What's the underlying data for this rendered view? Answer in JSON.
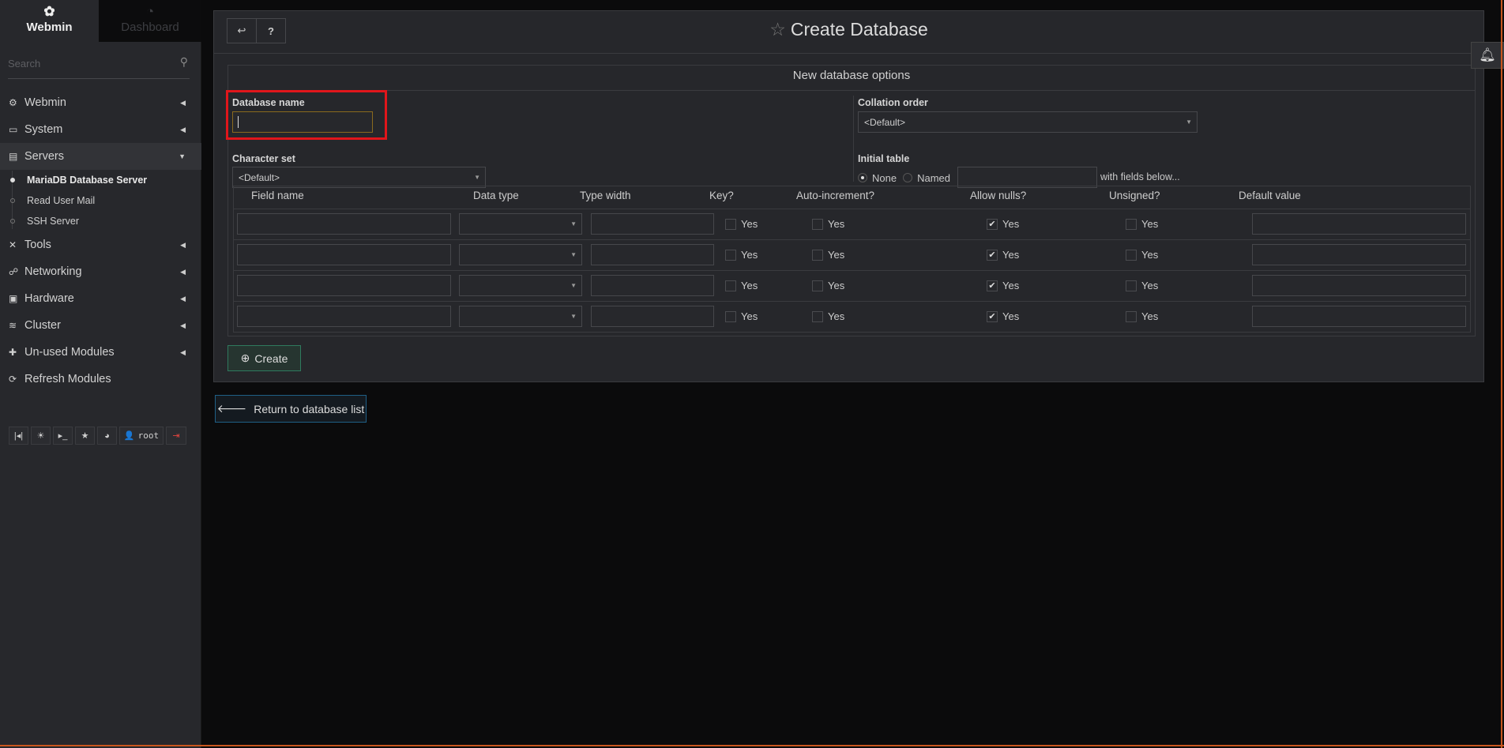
{
  "sidebar": {
    "tabs": [
      {
        "label": "Webmin",
        "icon": "webmin-logo-icon"
      },
      {
        "label": "Dashboard",
        "icon": "dashboard-gauge-icon"
      }
    ],
    "search_placeholder": "Search",
    "menu": [
      {
        "label": "Webmin",
        "icon": "gear-icon"
      },
      {
        "label": "System",
        "icon": "laptop-icon"
      },
      {
        "label": "Servers",
        "icon": "server-icon",
        "expanded": true
      },
      {
        "label": "Tools",
        "icon": "tools-icon"
      },
      {
        "label": "Networking",
        "icon": "network-icon"
      },
      {
        "label": "Hardware",
        "icon": "harddisk-icon"
      },
      {
        "label": "Cluster",
        "icon": "layers-icon"
      },
      {
        "label": "Un-used Modules",
        "icon": "puzzle-icon"
      },
      {
        "label": "Refresh Modules",
        "icon": "refresh-icon"
      }
    ],
    "submenu": [
      {
        "label": "MariaDB Database Server",
        "active": true
      },
      {
        "label": "Read User Mail"
      },
      {
        "label": "SSH Server"
      }
    ],
    "bottom": {
      "user": "root"
    }
  },
  "page": {
    "title": "Create Database"
  },
  "form": {
    "legend": "New database options",
    "db_name_label": "Database name",
    "db_name_value": "",
    "charset_label": "Character set",
    "charset_value": "<Default>",
    "collation_label": "Collation order",
    "collation_value": "<Default>",
    "initial_table_label": "Initial table",
    "radio_none": "None",
    "radio_named": "Named",
    "fields_suffix": "with fields below...",
    "columns": [
      "Field name",
      "Data type",
      "Type width",
      "Key?",
      "Auto-increment?",
      "Allow nulls?",
      "Unsigned?",
      "Default value"
    ],
    "rows": [
      {
        "key": false,
        "auto": false,
        "nulls": true,
        "unsigned": false
      },
      {
        "key": false,
        "auto": false,
        "nulls": true,
        "unsigned": false
      },
      {
        "key": false,
        "auto": false,
        "nulls": true,
        "unsigned": false
      },
      {
        "key": false,
        "auto": false,
        "nulls": true,
        "unsigned": false
      }
    ],
    "yes": "Yes",
    "create_label": "Create"
  },
  "return_label": "Return to database list",
  "colors": {
    "highlight": "#e0161b",
    "create_border": "#2f7a5e",
    "return_border": "#1f5f86"
  }
}
